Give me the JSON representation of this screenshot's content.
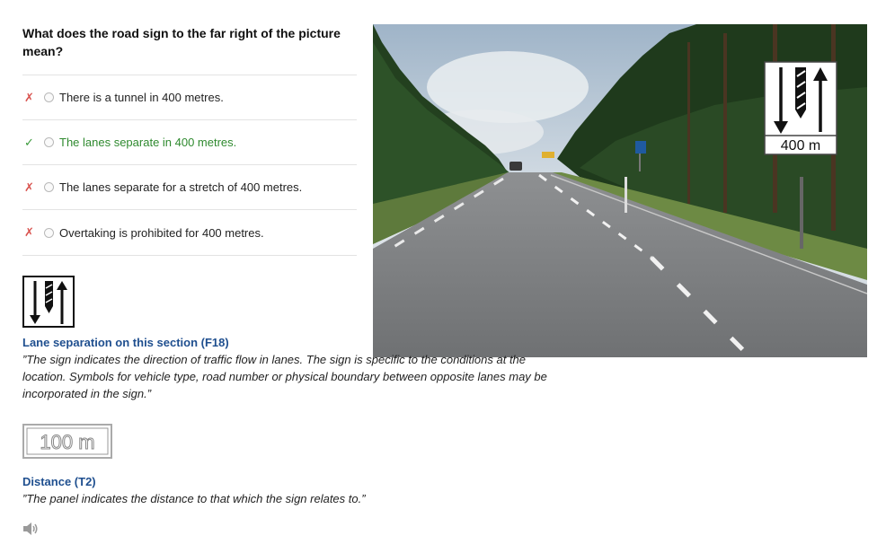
{
  "question": "What does the road sign to the far right of the picture mean?",
  "answers": [
    {
      "mark": "✗",
      "status": "wrong",
      "text": "There is a tunnel in 400 metres."
    },
    {
      "mark": "✓",
      "status": "correct",
      "text": "The lanes separate in 400 metres."
    },
    {
      "mark": "✗",
      "status": "wrong",
      "text": "The lanes separate for a stretch of 400 metres."
    },
    {
      "mark": "✗",
      "status": "wrong",
      "text": "Overtaking is prohibited for 400 metres."
    }
  ],
  "photo": {
    "sign_text": "400 m"
  },
  "explanations": [
    {
      "title": "Lane separation on this section (F18)",
      "text": "”The sign indicates the direction of traffic flow in lanes. The sign is specific to the conditions at the location. Symbols for vehicle type, road number or physical boundary between opposite lanes may be incorporated in the sign.”"
    },
    {
      "title": "Distance (T2)",
      "sign_text": "100 m",
      "text": "”The panel indicates the distance to that which the sign relates to.”"
    }
  ],
  "colors": {
    "correct": "#2f8a2f",
    "wrong": "#d9534f",
    "title_link": "#1f4f8f"
  },
  "icons": {
    "audio": "speaker-icon"
  }
}
